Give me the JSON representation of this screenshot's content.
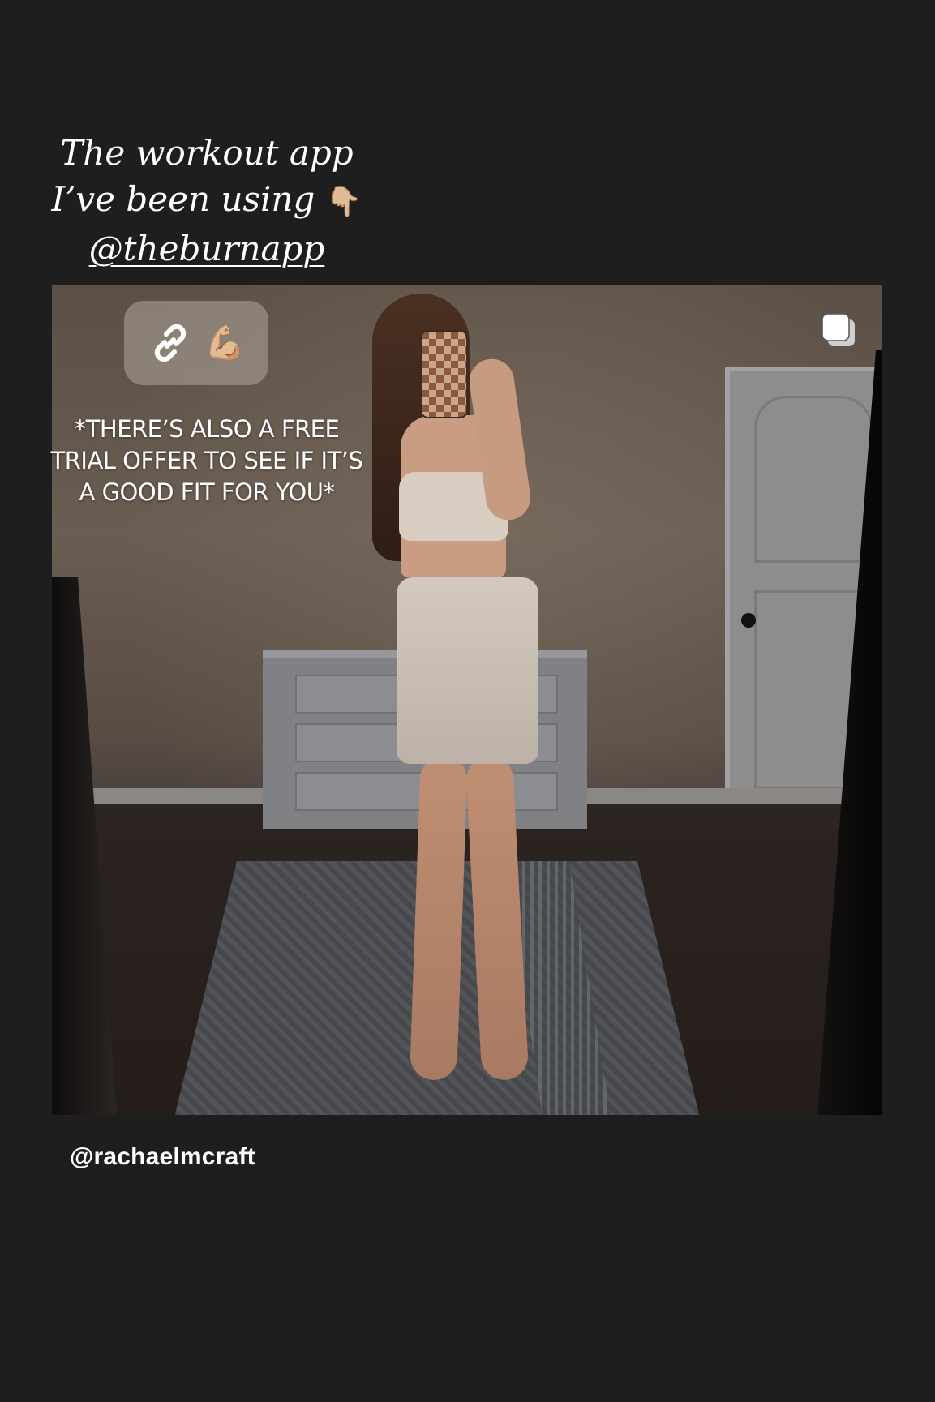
{
  "caption": {
    "line1": "The workout app",
    "line2": "I’ve been using",
    "line2_emoji": "👇🏼",
    "mention": "@theburnapp"
  },
  "link_sticker": {
    "icon": "link-icon",
    "emoji": "💪🏼"
  },
  "overlay_text": {
    "line1": "*THERE’S ALSO A FREE",
    "line2": "TRIAL OFFER TO SEE IF IT’S",
    "line3": "A GOOD FIT FOR YOU*"
  },
  "post": {
    "multi_post_icon": "carousel-icon",
    "author_handle": "@rachaelmcraft"
  },
  "colors": {
    "background": "#1e1e1f",
    "text": "#ffffff"
  }
}
